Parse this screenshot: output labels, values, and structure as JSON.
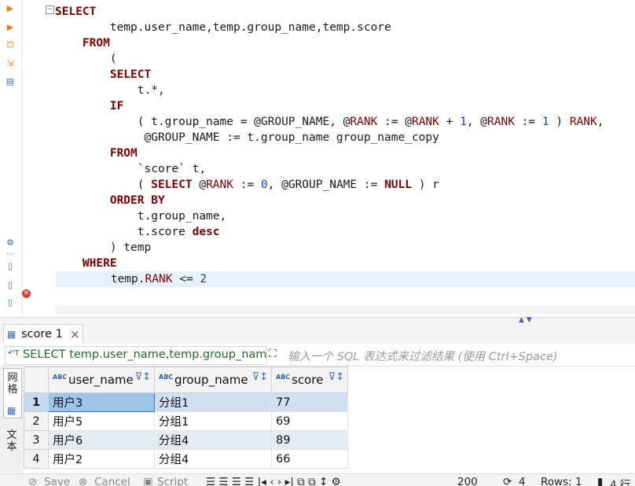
{
  "gutter_icons": [
    "play-icon",
    "run-script-icon",
    "explain-icon",
    "export-icon",
    "file-icon",
    "settings-icon",
    "more-icon",
    "new-file-icon",
    "sql-file-icon",
    "script-file-icon"
  ],
  "editor": {
    "fold_symbol": "−",
    "lines": [
      {
        "segs": [
          {
            "t": "SELECT",
            "c": "kw"
          }
        ]
      },
      {
        "segs": [
          {
            "t": "        temp.user_name,temp.group_name,temp.score",
            "c": ""
          }
        ]
      },
      {
        "segs": [
          {
            "t": "    ",
            "c": ""
          },
          {
            "t": "FROM",
            "c": "kw"
          }
        ]
      },
      {
        "segs": [
          {
            "t": "        (",
            "c": ""
          }
        ]
      },
      {
        "segs": [
          {
            "t": "        ",
            "c": ""
          },
          {
            "t": "SELECT",
            "c": "kw"
          }
        ]
      },
      {
        "segs": [
          {
            "t": "            t.*,",
            "c": ""
          }
        ]
      },
      {
        "segs": [
          {
            "t": "        ",
            "c": ""
          },
          {
            "t": "IF",
            "c": "kw"
          }
        ]
      },
      {
        "segs": [
          {
            "t": "            ( t.group_name = @GROUP_NAME, @",
            "c": ""
          },
          {
            "t": "RANK",
            "c": "var"
          },
          {
            "t": " := @",
            "c": ""
          },
          {
            "t": "RANK",
            "c": "var"
          },
          {
            "t": " + ",
            "c": ""
          },
          {
            "t": "1",
            "c": "num"
          },
          {
            "t": ", @",
            "c": ""
          },
          {
            "t": "RANK",
            "c": "var"
          },
          {
            "t": " := ",
            "c": ""
          },
          {
            "t": "1",
            "c": "num"
          },
          {
            "t": " ) ",
            "c": ""
          },
          {
            "t": "RANK",
            "c": "var"
          },
          {
            "t": ",",
            "c": ""
          }
        ]
      },
      {
        "segs": [
          {
            "t": "             @GROUP_NAME := t.group_name group_name_copy",
            "c": ""
          }
        ]
      },
      {
        "segs": [
          {
            "t": "        ",
            "c": ""
          },
          {
            "t": "FROM",
            "c": "kw"
          }
        ]
      },
      {
        "segs": [
          {
            "t": "            `score` t,",
            "c": ""
          }
        ]
      },
      {
        "segs": [
          {
            "t": "            ( ",
            "c": ""
          },
          {
            "t": "SELECT",
            "c": "kw"
          },
          {
            "t": " @",
            "c": ""
          },
          {
            "t": "RANK",
            "c": "var"
          },
          {
            "t": " := ",
            "c": ""
          },
          {
            "t": "0",
            "c": "num"
          },
          {
            "t": ", @GROUP_NAME := ",
            "c": ""
          },
          {
            "t": "NULL",
            "c": "kw"
          },
          {
            "t": " ) r",
            "c": ""
          }
        ]
      },
      {
        "segs": [
          {
            "t": "        ",
            "c": ""
          },
          {
            "t": "ORDER BY",
            "c": "kw"
          }
        ]
      },
      {
        "segs": [
          {
            "t": "            t.group_name,",
            "c": ""
          }
        ]
      },
      {
        "segs": [
          {
            "t": "            t.score ",
            "c": ""
          },
          {
            "t": "desc",
            "c": "kw"
          }
        ]
      },
      {
        "segs": [
          {
            "t": "        ) temp",
            "c": ""
          }
        ]
      },
      {
        "segs": [
          {
            "t": "    ",
            "c": ""
          },
          {
            "t": "WHERE",
            "c": "kw"
          }
        ]
      },
      {
        "segs": [
          {
            "t": "        temp.",
            "c": ""
          },
          {
            "t": "RANK",
            "c": "var"
          },
          {
            "t": " <= ",
            "c": ""
          },
          {
            "t": "2",
            "c": "num"
          }
        ],
        "current": true
      }
    ]
  },
  "results_tab": {
    "label": "score 1",
    "close": "×",
    "icon": "table-icon"
  },
  "panel_arrows": "▲▼",
  "filter": {
    "query_text": "SELECT temp.user_name,temp.group_name,temp.score",
    "query_icon_text": "↶T",
    "expand_icon": "⛶",
    "placeholder": "输入一个 SQL 表达式来过滤结果 (使用 Ctrl+Space)"
  },
  "side_tabs": [
    {
      "label": "网格",
      "icon": "grid-icon"
    },
    {
      "label": "文本",
      "icon": "text-icon"
    }
  ],
  "grid": {
    "type_badge": "ABC",
    "columns": [
      "user_name",
      "group_name",
      "score"
    ],
    "rows": [
      {
        "n": "1",
        "cells": [
          "用户3",
          "分组1",
          "77"
        ]
      },
      {
        "n": "2",
        "cells": [
          "用户5",
          "分组1",
          "69"
        ]
      },
      {
        "n": "3",
        "cells": [
          "用户6",
          "分组4",
          "89"
        ]
      },
      {
        "n": "4",
        "cells": [
          "用户2",
          "分组4",
          "66"
        ]
      }
    ]
  },
  "bottom_bar": {
    "save": "Save",
    "cancel": "Cancel",
    "script": "Script",
    "fetch_size": "200",
    "refresh_count": "4",
    "rows": "Rows: 1",
    "row_count": "4 行"
  }
}
